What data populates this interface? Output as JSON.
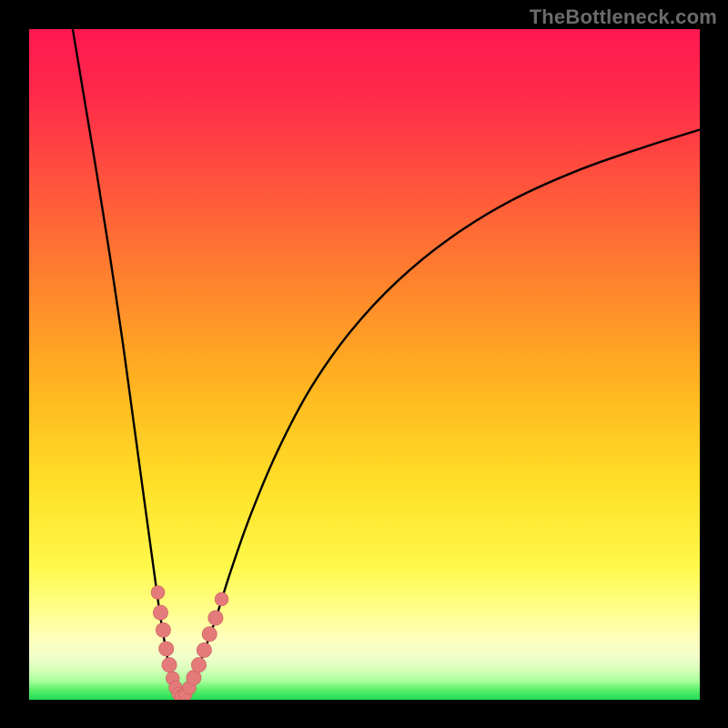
{
  "watermark": "TheBottleneck.com",
  "colors": {
    "frame": "#000000",
    "curve": "#000000",
    "marker_fill": "#e47a7a",
    "marker_stroke": "#c85b5b",
    "gradient_stops": [
      {
        "offset": 0.0,
        "color": "#ff1850"
      },
      {
        "offset": 0.1,
        "color": "#ff2a4a"
      },
      {
        "offset": 0.25,
        "color": "#ff5a3a"
      },
      {
        "offset": 0.4,
        "color": "#ff8a2a"
      },
      {
        "offset": 0.55,
        "color": "#ffba20"
      },
      {
        "offset": 0.68,
        "color": "#ffe028"
      },
      {
        "offset": 0.8,
        "color": "#fff84a"
      },
      {
        "offset": 0.865,
        "color": "#ffff8a"
      },
      {
        "offset": 0.905,
        "color": "#ffffb8"
      },
      {
        "offset": 0.935,
        "color": "#f2ffca"
      },
      {
        "offset": 0.955,
        "color": "#d6ffba"
      },
      {
        "offset": 0.972,
        "color": "#a8ff9a"
      },
      {
        "offset": 0.985,
        "color": "#5af06a"
      },
      {
        "offset": 1.0,
        "color": "#1fdc55"
      }
    ]
  },
  "chart_data": {
    "type": "line",
    "title": "",
    "xlabel": "",
    "ylabel": "",
    "xlim": [
      0,
      100
    ],
    "ylim": [
      0,
      100
    ],
    "grid": false,
    "series": [
      {
        "name": "left-branch",
        "x": [
          6.5,
          8,
          10,
          12,
          14,
          15.5,
          17,
          18.3,
          19.4,
          20.3,
          21.0,
          21.7,
          22.3,
          22.8
        ],
        "y": [
          100,
          91,
          79,
          66.5,
          53,
          42,
          31,
          21.5,
          13.5,
          8.0,
          4.5,
          2.2,
          0.8,
          0.0
        ]
      },
      {
        "name": "right-branch",
        "x": [
          22.8,
          23.3,
          24.0,
          25.0,
          26.2,
          27.8,
          30,
          33,
          37,
          42,
          48,
          55,
          63,
          72,
          82,
          92,
          100
        ],
        "y": [
          0.0,
          0.7,
          2.0,
          4.2,
          7.5,
          12.0,
          19.0,
          27.5,
          37.0,
          46.5,
          55.0,
          62.5,
          69.0,
          74.5,
          79.0,
          82.5,
          85.0
        ]
      }
    ],
    "markers": {
      "name": "highlighted-points",
      "points": [
        {
          "x": 19.2,
          "y": 16.0,
          "r": 1.0
        },
        {
          "x": 19.6,
          "y": 13.0,
          "r": 1.1
        },
        {
          "x": 20.0,
          "y": 10.4,
          "r": 1.1
        },
        {
          "x": 20.45,
          "y": 7.6,
          "r": 1.1
        },
        {
          "x": 20.9,
          "y": 5.2,
          "r": 1.1
        },
        {
          "x": 21.4,
          "y": 3.2,
          "r": 1.0
        },
        {
          "x": 21.85,
          "y": 1.8,
          "r": 1.0
        },
        {
          "x": 22.3,
          "y": 0.9,
          "r": 1.0
        },
        {
          "x": 22.8,
          "y": 0.4,
          "r": 1.1
        },
        {
          "x": 23.3,
          "y": 0.8,
          "r": 1.0
        },
        {
          "x": 23.9,
          "y": 1.8,
          "r": 1.0
        },
        {
          "x": 24.55,
          "y": 3.3,
          "r": 1.1
        },
        {
          "x": 25.3,
          "y": 5.2,
          "r": 1.1
        },
        {
          "x": 26.1,
          "y": 7.4,
          "r": 1.1
        },
        {
          "x": 26.9,
          "y": 9.8,
          "r": 1.1
        },
        {
          "x": 27.8,
          "y": 12.2,
          "r": 1.1
        },
        {
          "x": 28.7,
          "y": 15.0,
          "r": 1.0
        }
      ]
    }
  }
}
